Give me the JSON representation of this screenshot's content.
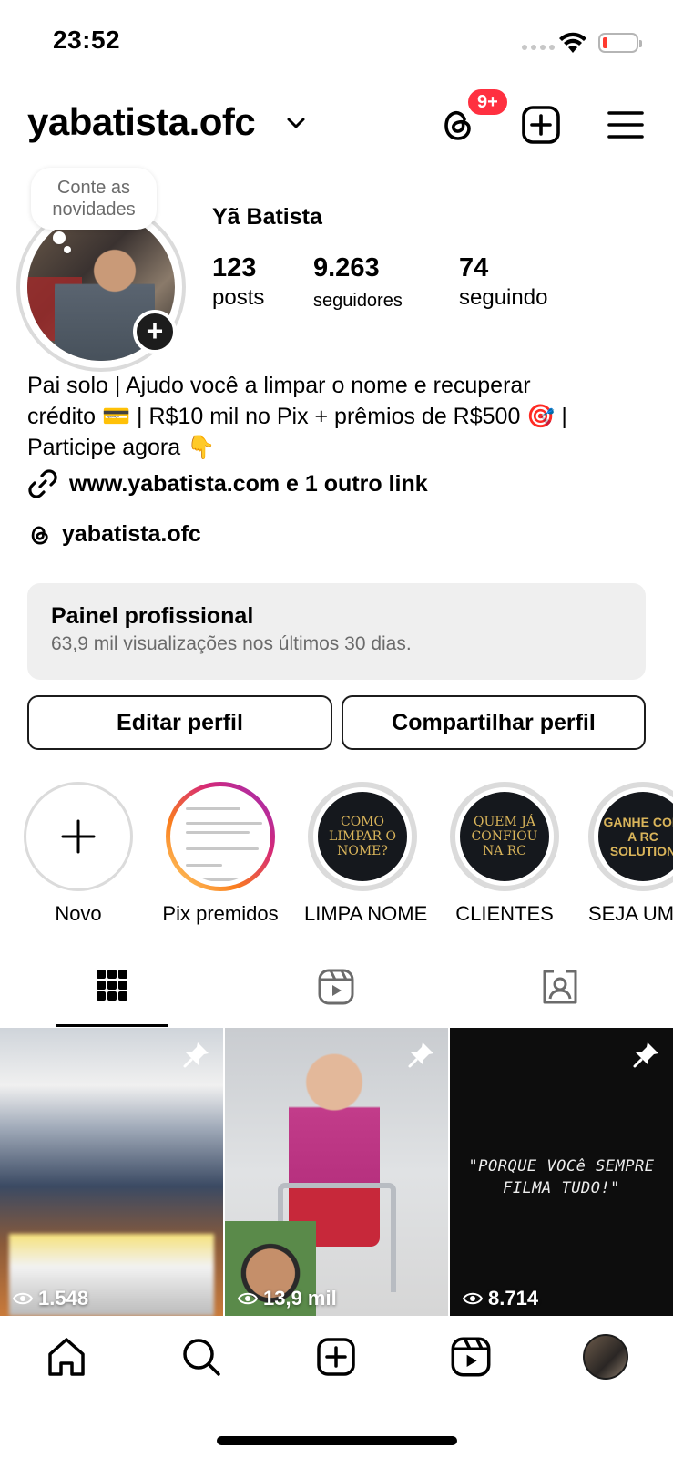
{
  "status_bar": {
    "time": "23:52"
  },
  "header": {
    "username": "yabatista.ofc",
    "threads_badge": "9+"
  },
  "profile": {
    "note": "Conte as novidades",
    "full_name": "Yã Batista",
    "stats": [
      {
        "value": "123",
        "label": "posts"
      },
      {
        "value": "9.263",
        "label": "seguidores"
      },
      {
        "value": "74",
        "label": "seguindo"
      }
    ],
    "bio_line1": "Pai solo | Ajudo você a limpar o nome e recuperar",
    "bio_line2": "crédito 💳 | R$10 mil no Pix + prêmios de R$500 🎯 |",
    "bio_line3": "Participe agora 👇",
    "link_text": "www.yabatista.com e 1 outro link",
    "threads_handle": "yabatista.ofc"
  },
  "professional_panel": {
    "title": "Painel profissional",
    "subtitle": "63,9 mil visualizações nos últimos 30 dias."
  },
  "buttons": {
    "edit": "Editar perfil",
    "share": "Compartilhar perfil"
  },
  "highlights": [
    {
      "label": "Novo",
      "cover_text": ""
    },
    {
      "label": "Pix premidos",
      "cover_text": ""
    },
    {
      "label": "LIMPA NOME",
      "cover_text": "COMO LIMPAR O NOME?"
    },
    {
      "label": "CLIENTES",
      "cover_text": "QUEM JÁ CONFIOU NA RC"
    },
    {
      "label": "SEJA UM",
      "cover_text": "GANHE COM A RC SOLUTION"
    }
  ],
  "grid": [
    {
      "views": "1.548"
    },
    {
      "views": "13,9 mil"
    },
    {
      "views": "8.714",
      "quote": "\"PORQUE VOCê SEMPRE FILMA TUDO!\""
    }
  ],
  "colors": {
    "badge": "#ff3040",
    "panel_bg": "#efefef",
    "muted_text": "#6b6b6b",
    "highlight_gold": "#d9b45a"
  },
  "icons": {
    "header": [
      "threads-icon",
      "create-icon",
      "menu-icon"
    ],
    "tabs": [
      "grid-icon",
      "reels-icon",
      "tagged-icon"
    ],
    "nav": [
      "home-icon",
      "search-icon",
      "create-icon",
      "reels-icon",
      "profile-avatar"
    ]
  }
}
